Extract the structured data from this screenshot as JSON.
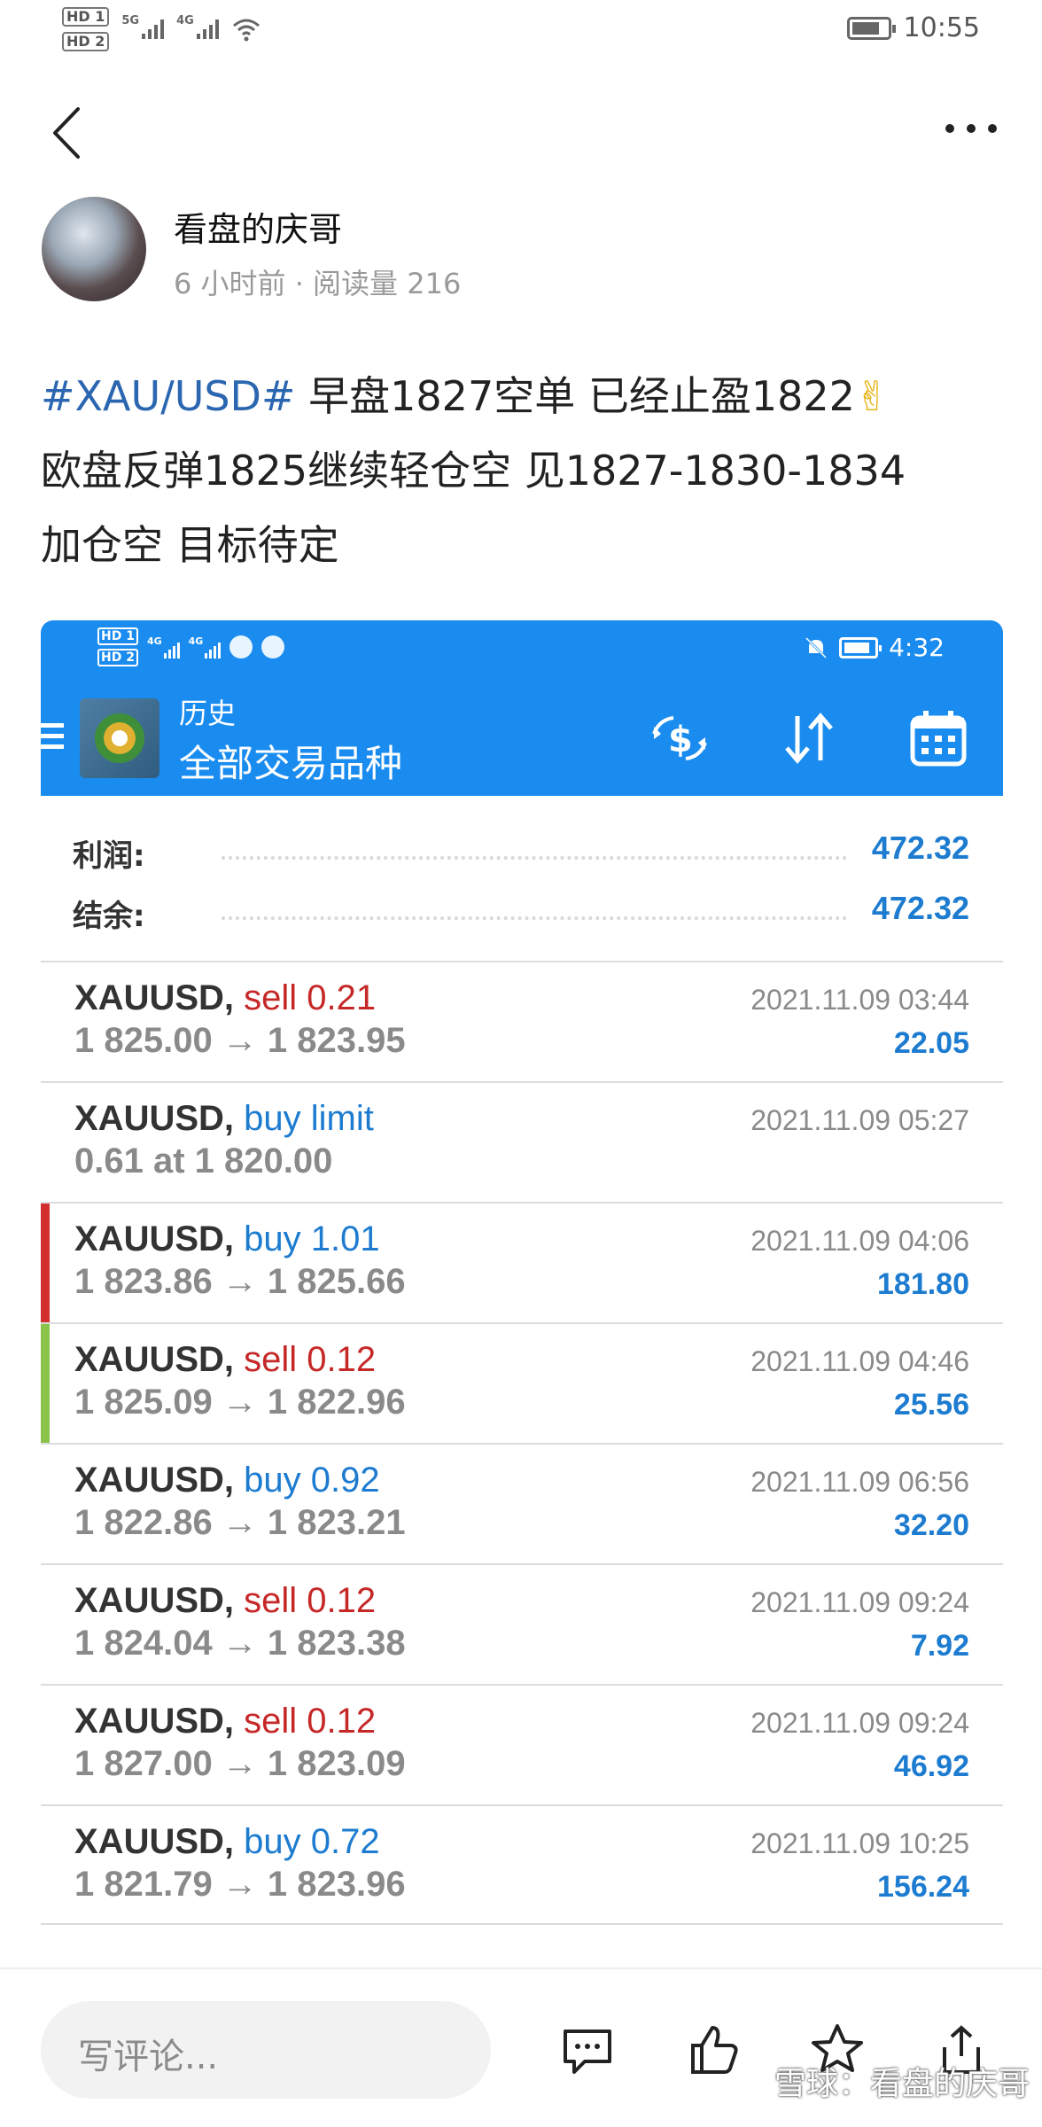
{
  "status_bar": {
    "hd1": "HD 1",
    "hd2": "HD 2",
    "net1": "5G",
    "net2": "4G",
    "time": "10:55"
  },
  "author": {
    "name": "看盘的庆哥",
    "meta": "6 小时前 · 阅读量 216"
  },
  "post": {
    "hashtag": "#XAU/USD#",
    "line1_rest": " 早盘1827空单 已经止盈1822",
    "emoji": "✌",
    "line2": "欧盘反弹1825继续轻仓空 见1827-1830-1834",
    "line3": "加仓空 目标待定"
  },
  "screenshot": {
    "status": {
      "hd1": "HD 1",
      "hd2": "HD 2",
      "net1": "4G",
      "net2": "4G",
      "time": "4:32"
    },
    "title_small": "历史",
    "title_big": "全部交易品种",
    "summary": [
      {
        "label": "利润:",
        "value": "472.32"
      },
      {
        "label": "结余:",
        "value": "472.32"
      }
    ],
    "trades": [
      {
        "symbol": "XAUUSD,",
        "side": "sell 0.21",
        "side_type": "sell",
        "prices": "1 825.00 → 1 823.95",
        "time": "2021.11.09 03:44",
        "profit": "22.05",
        "marker": ""
      },
      {
        "symbol": "XAUUSD,",
        "side": "buy limit",
        "side_type": "buy",
        "prices": "0.61 at 1 820.00",
        "time": "2021.11.09 05:27",
        "profit": "",
        "marker": ""
      },
      {
        "symbol": "XAUUSD,",
        "side": "buy 1.01",
        "side_type": "buy",
        "prices": "1 823.86 → 1 825.66",
        "time": "2021.11.09 04:06",
        "profit": "181.80",
        "marker": "#d32f2f"
      },
      {
        "symbol": "XAUUSD,",
        "side": "sell 0.12",
        "side_type": "sell",
        "prices": "1 825.09 → 1 822.96",
        "time": "2021.11.09 04:46",
        "profit": "25.56",
        "marker": "#8bc34a"
      },
      {
        "symbol": "XAUUSD,",
        "side": "buy 0.92",
        "side_type": "buy",
        "prices": "1 822.86 → 1 823.21",
        "time": "2021.11.09 06:56",
        "profit": "32.20",
        "marker": ""
      },
      {
        "symbol": "XAUUSD,",
        "side": "sell 0.12",
        "side_type": "sell",
        "prices": "1 824.04 → 1 823.38",
        "time": "2021.11.09 09:24",
        "profit": "7.92",
        "marker": ""
      },
      {
        "symbol": "XAUUSD,",
        "side": "sell 0.12",
        "side_type": "sell",
        "prices": "1 827.00 → 1 823.09",
        "time": "2021.11.09 09:24",
        "profit": "46.92",
        "marker": ""
      },
      {
        "symbol": "XAUUSD,",
        "side": "buy 0.72",
        "side_type": "buy",
        "prices": "1 821.79 → 1 823.96",
        "time": "2021.11.09 10:25",
        "profit": "156.24",
        "marker": ""
      }
    ]
  },
  "bottom": {
    "comment_placeholder": "写评论...",
    "watermark": "雪球：看盘的庆哥"
  },
  "colors": {
    "hashtag": "#2b66b0",
    "header_blue": "#1a8cf0",
    "sell_red": "#c62828",
    "buy_blue": "#1d7cd0",
    "profit_blue": "#1d7cd0"
  },
  "icons": {
    "back": "back-arrow-icon",
    "more": "more-icon",
    "menu": "hamburger-menu-icon",
    "exchange": "currency-exchange-icon",
    "sort": "sort-icon",
    "calendar": "calendar-icon",
    "comment": "comment-icon",
    "like": "thumbs-up-icon",
    "favorite": "star-icon",
    "share": "share-icon"
  }
}
